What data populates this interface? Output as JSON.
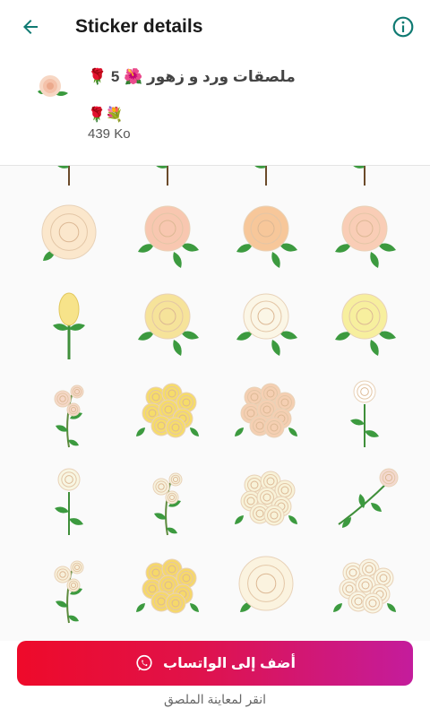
{
  "topbar": {
    "title": "Sticker details",
    "back_icon": "arrow-left-icon",
    "info_icon": "info-icon",
    "accent_color": "#0f7a72"
  },
  "pack": {
    "name": "🌹 ملصقات ورد و زهور 🌺 5",
    "author": "🌹💐",
    "size": "439 Ko"
  },
  "stickers": [
    {
      "kind": "stem",
      "color": "#2e8b3a"
    },
    {
      "kind": "stem",
      "color": "#2e8b3a"
    },
    {
      "kind": "stem",
      "color": "#2e8b3a"
    },
    {
      "kind": "stem",
      "color": "#2e8b3a"
    },
    {
      "kind": "rose-big",
      "color": "#fbe7cc"
    },
    {
      "kind": "rose-leaf",
      "color": "#f8c7b0"
    },
    {
      "kind": "rose-leaf",
      "color": "#f7c79a"
    },
    {
      "kind": "rose-leaf",
      "color": "#f9cdb6"
    },
    {
      "kind": "bud",
      "color": "#f7e38a"
    },
    {
      "kind": "rose-leaf",
      "color": "#f6e39a"
    },
    {
      "kind": "rose-leaf",
      "color": "#fbf6e6"
    },
    {
      "kind": "rose-leaf",
      "color": "#f7ef9e"
    },
    {
      "kind": "sprig",
      "color": "#f6d8c8"
    },
    {
      "kind": "bouquet",
      "color": "#f6dc6a"
    },
    {
      "kind": "bouquet",
      "color": "#f5cfb2"
    },
    {
      "kind": "single",
      "color": "#ffffff"
    },
    {
      "kind": "single",
      "color": "#f8f6e2"
    },
    {
      "kind": "sprig",
      "color": "#f7f2de"
    },
    {
      "kind": "bouquet",
      "color": "#f8f2d8"
    },
    {
      "kind": "branch",
      "color": "#f4d9cf"
    },
    {
      "kind": "sprig",
      "color": "#f8f0da"
    },
    {
      "kind": "bouquet",
      "color": "#f6d86a"
    },
    {
      "kind": "rose-big",
      "color": "#fbf3df"
    },
    {
      "kind": "bouquet",
      "color": "#f9f5e4"
    }
  ],
  "add_button": {
    "label": "أضف إلى الواتساب",
    "icon": "whatsapp-icon"
  },
  "hint": "انقر لمعاينة الملصق"
}
